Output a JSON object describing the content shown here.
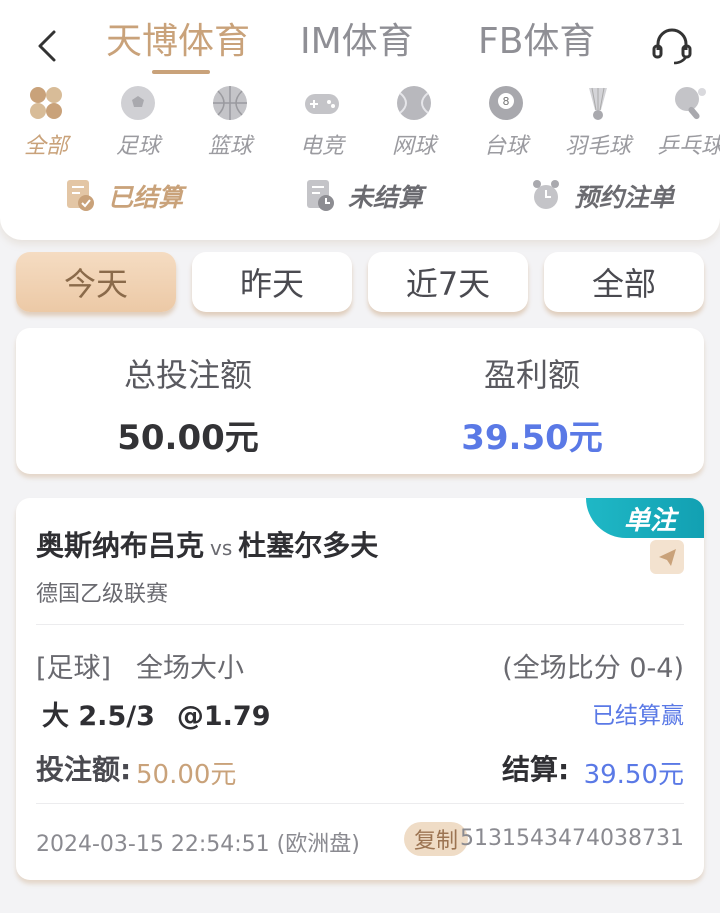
{
  "header": {
    "tabs": [
      {
        "label": "天博体育",
        "active": true
      },
      {
        "label": "IM体育",
        "active": false
      },
      {
        "label": "FB体育",
        "active": false
      }
    ]
  },
  "sports": [
    {
      "label": "全部",
      "icon": "clover-icon",
      "active": true
    },
    {
      "label": "足球",
      "icon": "soccer-ball-icon",
      "active": false
    },
    {
      "label": "篮球",
      "icon": "basketball-icon",
      "active": false
    },
    {
      "label": "电竞",
      "icon": "gamepad-icon",
      "active": false
    },
    {
      "label": "网球",
      "icon": "tennis-ball-icon",
      "active": false
    },
    {
      "label": "台球",
      "icon": "billiard-ball-icon",
      "active": false
    },
    {
      "label": "羽毛球",
      "icon": "shuttlecock-icon",
      "active": false
    },
    {
      "label": "乒乓球",
      "icon": "ping-pong-icon",
      "active": false
    }
  ],
  "status_tabs": [
    {
      "label": "已结算",
      "active": true
    },
    {
      "label": "未结算",
      "active": false
    },
    {
      "label": "预约注单",
      "active": false
    }
  ],
  "filters": [
    {
      "label": "今天",
      "active": true
    },
    {
      "label": "昨天",
      "active": false
    },
    {
      "label": "近7天",
      "active": false
    },
    {
      "label": "全部",
      "active": false
    }
  ],
  "summary": {
    "total_label": "总投注额",
    "total_value": "50.00元",
    "profit_label": "盈利额",
    "profit_value": "39.50元"
  },
  "bet": {
    "badge": "单注",
    "home_team": "奥斯纳布吕克",
    "vs": "vs",
    "away_team": "杜塞尔多夫",
    "league": "德国乙级联赛",
    "sport_tag": "[足球]",
    "market": "全场大小",
    "full_score": "(全场比分 0-4)",
    "selection": "大 2.5/3",
    "odds": "@1.79",
    "result": "已结算赢",
    "stake_label": "投注额:",
    "stake_value": "50.00元",
    "settle_label": "结算:",
    "settle_value": "39.50元",
    "time": "2024-03-15 22:54:51 (欧洲盘)",
    "copy_label": "复制",
    "order_id": "5131543474038731"
  },
  "colors": {
    "accent": "#c9a27a",
    "profit_blue": "#5a79e6",
    "badge_teal": "#1fb8c6"
  }
}
